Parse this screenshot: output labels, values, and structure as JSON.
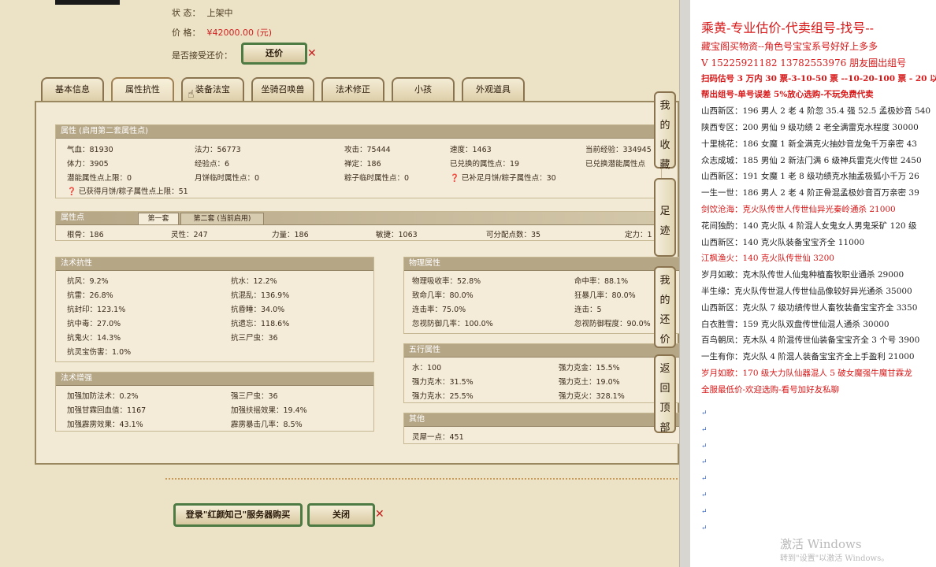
{
  "info": {
    "status_label": "状 态：",
    "status_value": "上架中",
    "price_label": "价 格：",
    "price_value": "¥42000.00 (元)",
    "counter_label": "是否接受还价：",
    "counter_btn": "还价",
    "x": "✕"
  },
  "tabs": [
    "基本信息",
    "属性抗性",
    "装备法宝",
    "坐骑召唤兽",
    "法术修正",
    "小孩",
    "外观道具"
  ],
  "attr_section": {
    "title": "属性 (启用第二套属性点)",
    "rows": [
      [
        "气血：81930",
        "法力：56773",
        "攻击：75444",
        "速度：1463",
        "当前经验：334945"
      ],
      [
        "体力：3905",
        "经验点：6",
        "禅定：186",
        "已兑换的属性点：19",
        "已兑换潜能属性点"
      ],
      [
        "潜能属性点上限：0",
        "月饼临时属性点：0",
        "粽子临时属性点：0",
        "已补足月饼/粽子属性点：30",
        ""
      ]
    ],
    "note": "已获得月饼/粽子属性点上限：51"
  },
  "points_section": {
    "title": "属性点",
    "tab1": "第一套",
    "tab2": "第二套 (当前启用)",
    "values": [
      "根骨：186",
      "灵性：247",
      "力量：186",
      "敏捷：1063",
      "可分配点数：35",
      "定力：1"
    ]
  },
  "resist": {
    "title": "法术抗性",
    "rows": [
      [
        "抗风：9.2%",
        "抗水：12.2%"
      ],
      [
        "抗雷：26.8%",
        "抗混乱：136.9%"
      ],
      [
        "抗封印：123.1%",
        "抗昏睡：34.0%"
      ],
      [
        "抗中毒：27.0%",
        "抗遗忘：118.6%"
      ],
      [
        "抗鬼火：14.3%",
        "抗三尸虫：36"
      ],
      [
        "抗灵宝伤害：1.0%",
        ""
      ]
    ]
  },
  "enhance": {
    "title": "法术增强",
    "rows": [
      [
        "加强加防法术：0.2%",
        "强三尸虫：36"
      ],
      [
        "加强甘霖回血值：1167",
        "加强扶摇效果：19.4%"
      ],
      [
        "加强霹雳效果：43.1%",
        "霹雳暴击几率：8.5%"
      ]
    ]
  },
  "physical": {
    "title": "物理属性",
    "rows": [
      [
        "物理吸收率：52.8%",
        "命中率：88.1%"
      ],
      [
        "致命几率：80.0%",
        "狂暴几率：80.0%"
      ],
      [
        "连击率：75.0%",
        "连击：5"
      ],
      [
        "忽视防御几率：100.0%",
        "忽视防御程度：90.0%"
      ]
    ]
  },
  "wuxing": {
    "title": "五行属性",
    "rows": [
      [
        "水：100",
        "强力克金：15.5%"
      ],
      [
        "强力克木：31.5%",
        "强力克土：19.0%"
      ],
      [
        "强力克水：25.5%",
        "强力克火：328.1%"
      ]
    ]
  },
  "other": {
    "title": "其他",
    "rows": [
      [
        "灵犀一点：451",
        ""
      ]
    ]
  },
  "bottom": {
    "login_btn": "登录\"红颜知己\"服务器购买",
    "close_btn": "关闭",
    "x": "✕"
  },
  "side": [
    "我的收藏",
    "足迹",
    "我的还价",
    "返回顶部"
  ],
  "right_panel": {
    "title": "乘黄-专业估价-代卖组号-找号--",
    "lines": [
      {
        "t": "藏宝阁买物资--角色号宝宝系号好好上多多",
        "c": "#d81818"
      },
      {
        "t": "V 15225921182   13782553976 朋友圈出组号",
        "c": "#d81818"
      },
      {
        "t": "扫码估号 3 万内 30 票-3-10-50 票 --10-20-100 票 - 20 以上",
        "c": "#d81818",
        "b": true
      },
      {
        "t": "帮出组号-单号误差 5%放心选购-不玩免费代卖",
        "c": "#d81818",
        "b": true
      },
      {
        "t": "山西新区：196 男人 2 老 4 阶忽 35.4 强 52.5 孟极妙音 540",
        "c": "#222"
      },
      {
        "t": "陕西专区：200 男仙 9 级功绩 2 老全满雷克水程度 30000",
        "c": "#222"
      },
      {
        "t": "十里桃花：186 女魔 1 新全满克火抽妙音龙兔千万亲密 43",
        "c": "#222"
      },
      {
        "t": "众志成城：185 男仙 2 新法门满 6 级神兵雷克火传世 2450",
        "c": "#222"
      },
      {
        "t": "山西新区：191 女魔 1 老 8 级功绩克水抽孟极狐小千万 26",
        "c": "#222"
      },
      {
        "t": "一生一世：186 男人 2 老 4 阶正骨混孟极妙音百万亲密 39",
        "c": "#222"
      },
      {
        "t": "剑饮沧海：克火队传世人传世仙异光秦岭通杀 21000",
        "c": "#d81818"
      },
      {
        "t": "花间独酌：140 克火队 4 阶混人女鬼女人男鬼采矿 120 级",
        "c": "#222"
      },
      {
        "t": "山西新区：140 克火队装备宝宝齐全 11000",
        "c": "#222"
      },
      {
        "t": "江枫渔火：140 克火队传世仙 3200",
        "c": "#d81818"
      },
      {
        "t": "岁月如歌：克木队传世人仙鬼种植畜牧职业通杀 29000",
        "c": "#222"
      },
      {
        "t": "半生缘：克火队传世混人传世仙品像较好异光通杀 35000",
        "c": "#222"
      },
      {
        "t": "山西新区：克火队 7 级功绩传世人畜牧装备宝宝齐全 3350",
        "c": "#222"
      },
      {
        "t": "白衣胜雪：159 克火队双盘传世仙混人通杀 30000",
        "c": "#222"
      },
      {
        "t": "百鸟朝凤：克木队 4 阶混传世仙装备宝宝齐全 3 个号 3900",
        "c": "#222"
      },
      {
        "t": "一生有你：克火队 4 阶混人装备宝宝齐全上手盈利 21000",
        "c": "#222"
      },
      {
        "t": "岁月如歌：170 级大力队仙器混人 5 破女魔强牛魔甘霖龙",
        "c": "#d81818"
      },
      {
        "t": "全服最低价-欢迎选购-看号加好友私聊",
        "c": "#d81818"
      }
    ]
  },
  "watermark": {
    "line1": "激活 Windows",
    "line2": "转到\"设置\"以激活 Windows。"
  }
}
